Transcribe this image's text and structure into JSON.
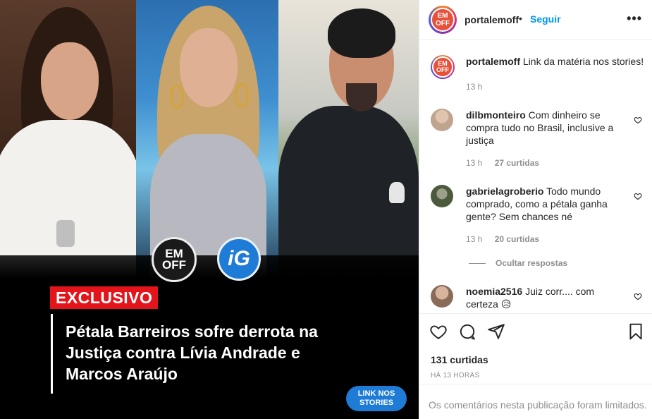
{
  "media": {
    "logo_emoff_line1": "EM",
    "logo_emoff_line2": "OFF",
    "logo_ig": "iG",
    "tag": "EXCLUSIVO",
    "headline": "Pétala Barreiros sofre derrota na Justiça contra Lívia Andrade e Marcos Araújo",
    "link_button_line1": "LINK NOS",
    "link_button_line2": "STORIES"
  },
  "header": {
    "avatar_line1": "EM",
    "avatar_line2": "OFF",
    "username": "portalemoff",
    "dot": "•",
    "follow_label": "Seguir",
    "more_label": "•••"
  },
  "caption": {
    "username": "portalemoff",
    "text": "Link da matéria nos stories!",
    "time": "13 h"
  },
  "comments": [
    {
      "username": "dilbmonteiro",
      "text": "Com dinheiro se compra tudo no Brasil, inclusive a justiça",
      "time": "13 h",
      "likes": "27 curtidas"
    },
    {
      "username": "gabrielagroberio",
      "text": "Todo mundo comprado, como a pétala ganha gente? Sem chances né",
      "time": "13 h",
      "likes": "20 curtidas"
    },
    {
      "username": "noemia2516",
      "text": "Juiz corr.... com certeza 😥"
    }
  ],
  "hide_replies_label": "Ocultar respostas",
  "actions": {
    "likes": "131 curtidas",
    "time_ago": "HÁ 13 HORAS"
  },
  "footer": {
    "limited_text": "Os comentários nesta publicação foram limitados."
  },
  "colors": {
    "accent_blue": "#0095f6",
    "tag_red": "#e4141b",
    "button_blue": "#1e7bd6"
  }
}
